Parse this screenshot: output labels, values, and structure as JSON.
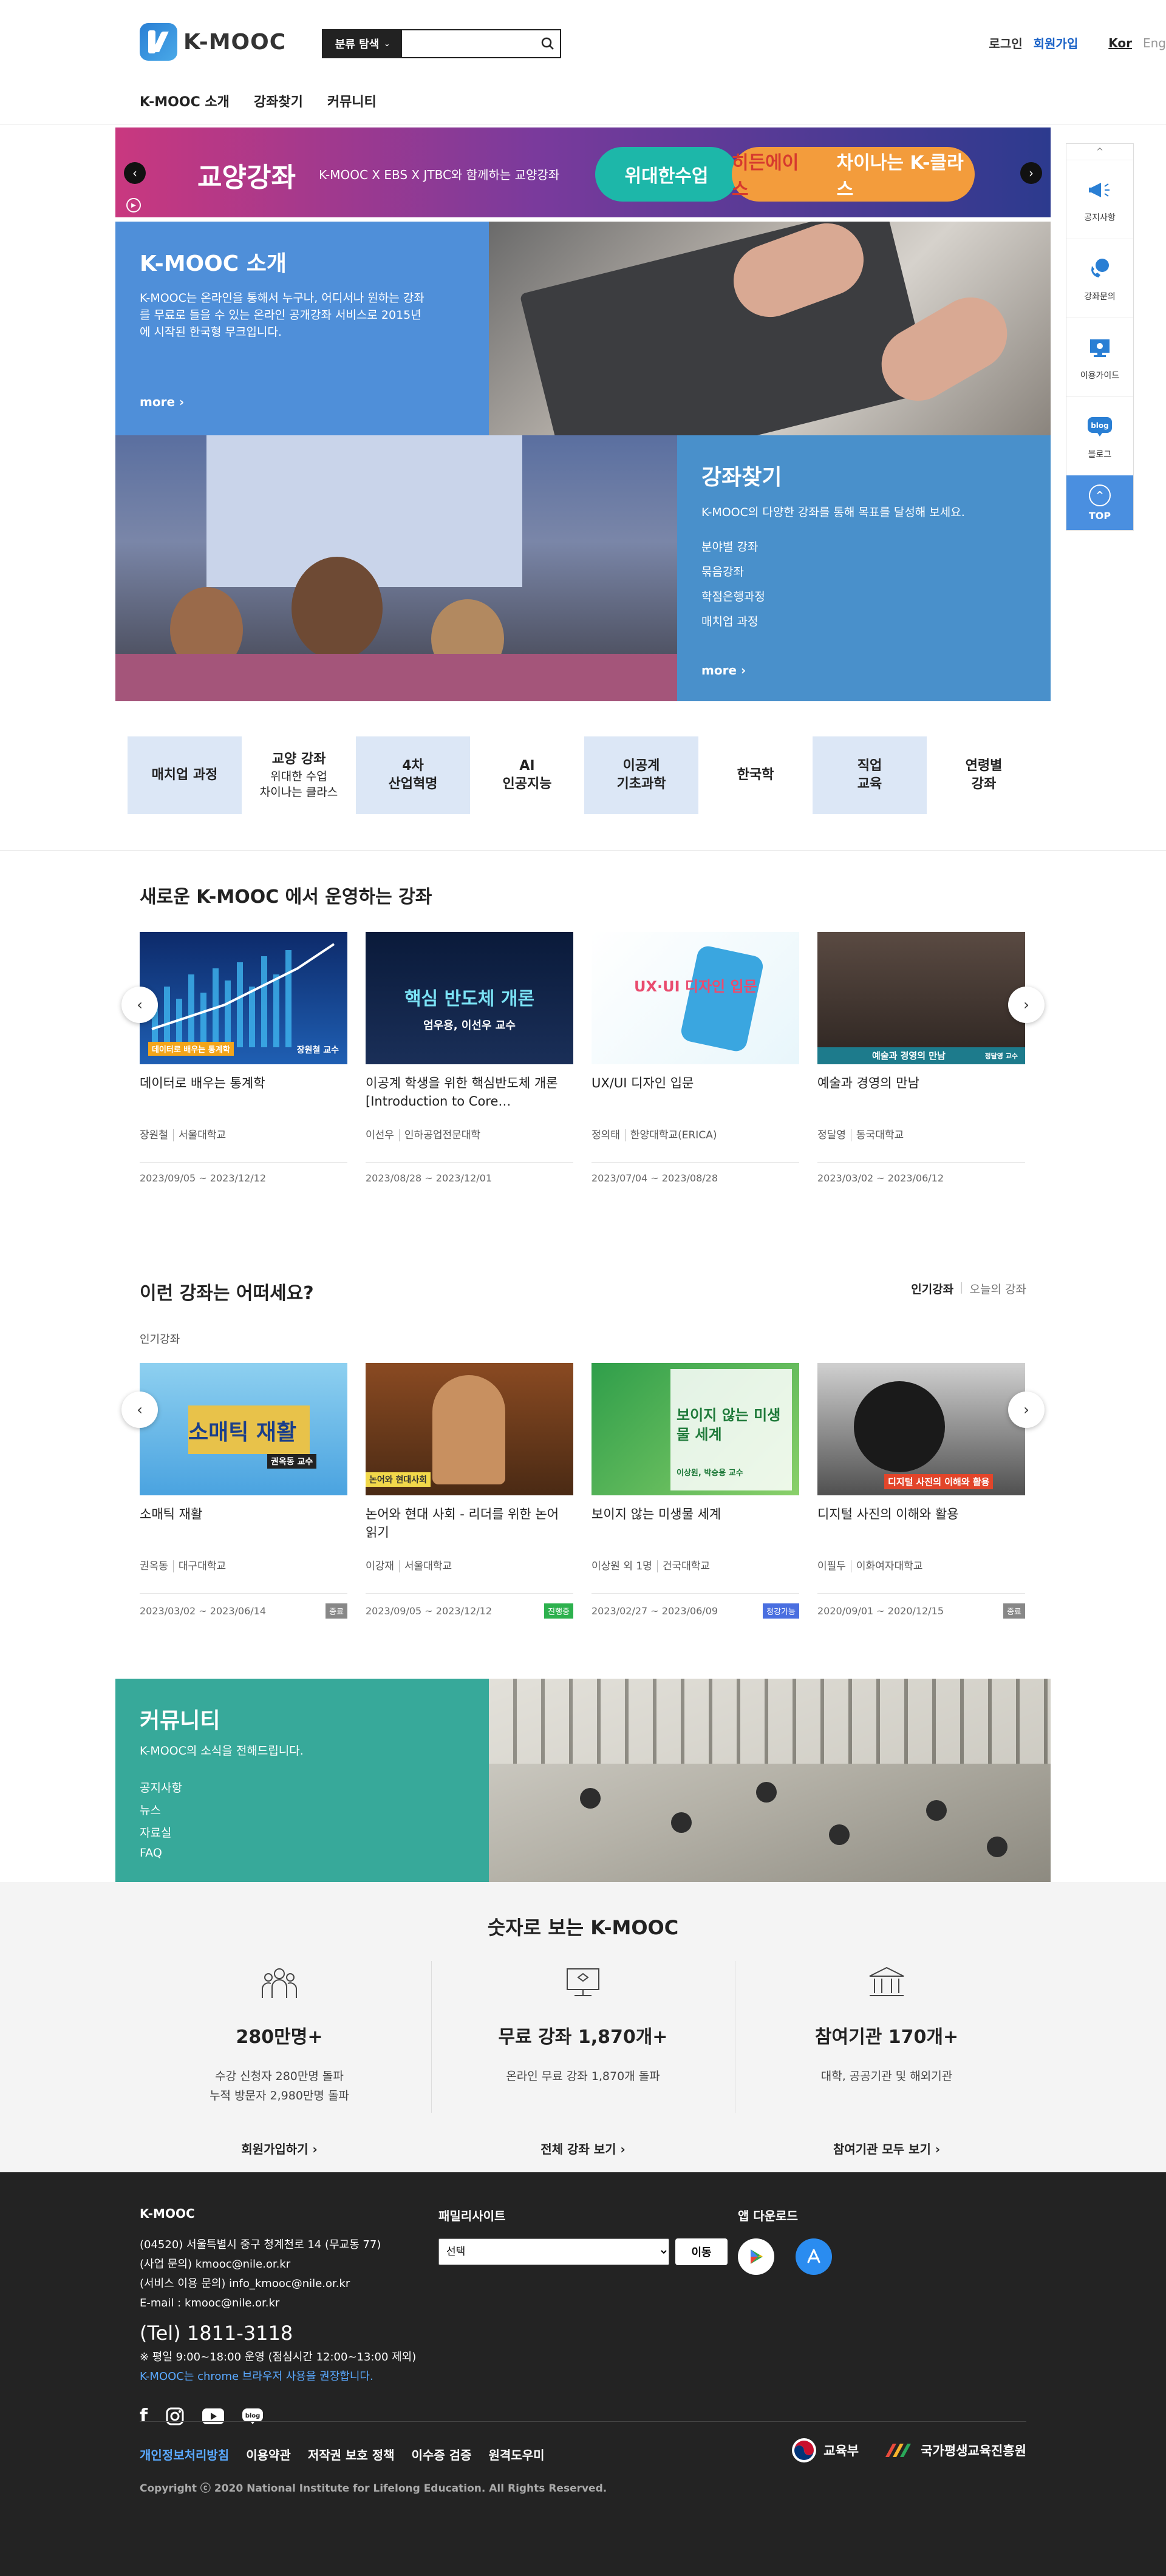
{
  "header": {
    "logo_text": "K-MOOC",
    "search_category": "분류 탐색",
    "search_placeholder": "",
    "login": "로그인",
    "signup": "회원가입",
    "lang_kor": "Kor",
    "lang_eng": "Eng",
    "nav": [
      "K-MOOC 소개",
      "강좌찾기",
      "커뮤니티"
    ]
  },
  "banner": {
    "title": "교양강좌",
    "subtitle": "K-MOOC X EBS X JTBC와 함께하는 교양강좌",
    "pill1": "위대한수업",
    "pill2a": "히든에이스",
    "pill2b": "차이나는 K-클라스"
  },
  "about": {
    "title": "K-MOOC 소개",
    "text": "K-MOOC는 온라인을 통해서 누구나, 어디서나 원하는 강좌를 무료로 들을 수 있는 온라인 공개강좌 서비스로 2015년에 시작된 한국형 무크입니다.",
    "more": "more ›"
  },
  "find": {
    "title": "강좌찾기",
    "text": "K-MOOC의 다양한 강좌를 통해 목표를 달성해 보세요.",
    "items": [
      "분야별 강좌",
      "묶음강좌",
      "학점은행과정",
      "매치업 과정"
    ],
    "more": "more ›"
  },
  "categories": [
    {
      "label": "매치업 과정",
      "sub": "",
      "blue": true
    },
    {
      "label": "교양 강좌",
      "sub": "위대한 수업\n차이나는 클라스",
      "blue": false
    },
    {
      "label": "4차\n산업혁명",
      "sub": "",
      "blue": true
    },
    {
      "label": "AI\n인공지능",
      "sub": "",
      "blue": false
    },
    {
      "label": "이공계\n기초과학",
      "sub": "",
      "blue": true
    },
    {
      "label": "한국학",
      "sub": "",
      "blue": false
    },
    {
      "label": "직업\n교육",
      "sub": "",
      "blue": true
    },
    {
      "label": "연령별\n강좌",
      "sub": "",
      "blue": false
    }
  ],
  "new_courses": {
    "title": "새로운 K-MOOC 에서 운영하는 강좌",
    "items": [
      {
        "title": "데이터로 배우는 통계학",
        "prof": "장원철",
        "univ": "서울대학교",
        "date": "2023/09/05 ~ 2023/12/12",
        "thumb_caption": "데이터로 배우는 통계학",
        "thumb_sub": "장원철 교수",
        "badge": ""
      },
      {
        "title": "이공계 학생을 위한 핵심반도체 개론 [Introduction to Core…",
        "prof": "이선우",
        "univ": "인하공업전문대학",
        "date": "2023/08/28 ~ 2023/12/01",
        "thumb_caption": "핵심 반도체 개론",
        "thumb_sub": "엄우용, 이선우 교수",
        "badge": ""
      },
      {
        "title": "UX/UI 디자인 입문",
        "prof": "정의태",
        "univ": "한양대학교(ERICA)",
        "date": "2023/07/04 ~ 2023/08/28",
        "thumb_caption": "UX·UI 디자인 입문",
        "thumb_sub": "",
        "badge": ""
      },
      {
        "title": "예술과 경영의 만남",
        "prof": "정달영",
        "univ": "동국대학교",
        "date": "2023/03/02 ~ 2023/06/12",
        "thumb_caption": "예술과 경영의 만남",
        "thumb_sub": "정달영 교수",
        "badge": ""
      }
    ]
  },
  "recommend": {
    "title": "이런 강좌는 어떠세요?",
    "tab_on": "인기강좌",
    "tab_off": "오늘의 강좌",
    "sub_label": "인기강좌",
    "items": [
      {
        "title": "소매틱 재활",
        "prof": "권옥동",
        "univ": "대구대학교",
        "date": "2023/03/02 ~ 2023/06/14",
        "thumb_caption": "소매틱 재활",
        "thumb_sub": "권옥동 교수",
        "badge": "종료",
        "badge_type": "end"
      },
      {
        "title": "논어와 현대 사회 - 리더를 위한 논어 읽기",
        "prof": "이강재",
        "univ": "서울대학교",
        "date": "2023/09/05 ~ 2023/12/12",
        "thumb_caption": "논어와 현대사회",
        "thumb_sub": "",
        "badge": "진행중",
        "badge_type": "open"
      },
      {
        "title": "보이지 않는 미생물 세계",
        "prof": "이상원 외 1명",
        "univ": "건국대학교",
        "date": "2023/02/27 ~ 2023/06/09",
        "thumb_caption": "보이지 않는 미생물 세계",
        "thumb_sub": "이상원, 박승용 교수",
        "badge": "청강가능",
        "badge_type": "now"
      },
      {
        "title": "디지털 사진의 이해와 활용",
        "prof": "이필두",
        "univ": "이화여자대학교",
        "date": "2020/09/01 ~ 2020/12/15",
        "thumb_caption": "디지털 사진의 이해와 활용",
        "thumb_sub": "",
        "badge": "종료",
        "badge_type": "end"
      }
    ]
  },
  "community": {
    "title": "커뮤니티",
    "text": "K-MOOC의 소식을 전해드립니다.",
    "items": [
      "공지사항",
      "뉴스",
      "자료실",
      "FAQ"
    ]
  },
  "stats": {
    "title": "숫자로 보는 K-MOOC",
    "items": [
      {
        "num": "280만명+",
        "line1": "수강 신청자 280만명 돌파",
        "line2": "누적 방문자 2,980만명 돌파",
        "link": "회원가입하기 ›"
      },
      {
        "num": "무료 강좌 1,870개+",
        "line1": "온라인 무료 강좌 1,870개 돌파",
        "line2": "",
        "link": "전체 강좌 보기 ›"
      },
      {
        "num": "참여기관 170개+",
        "line1": "대학, 공공기관 및 해외기관",
        "line2": "",
        "link": "참여기관 모두 보기 ›"
      }
    ]
  },
  "footer": {
    "title": "K-MOOC",
    "address": "(04520) 서울특별시 중구 청계천로 14 (무교동 77)",
    "biz_mail": "(사업 문의) kmooc@nile.or.kr",
    "svc_mail": "(서비스 이용 문의) info_kmooc@nile.or.kr",
    "email": "E-mail : kmooc@nile.or.kr",
    "tel": "(Tel) 1811-3118",
    "hours": "※ 평일 9:00~18:00 운영 (점심시간 12:00~13:00 제외)",
    "chrome": "K-MOOC는 chrome 브라우저 사용을 권장합니다.",
    "family_title": "패밀리사이트",
    "family_select": "선택",
    "family_go": "이동",
    "app_title": "앱 다운로드",
    "links": [
      "개인정보처리방침",
      "이용약관",
      "저작권 보호 정책",
      "이수증 검증",
      "원격도우미"
    ],
    "copyright": "Copyright ⓒ 2020 National Institute for Lifelong Education. All Rights Reserved.",
    "org1": "교육부",
    "org2": "국가평생교육진흥원"
  },
  "quick": {
    "items": [
      "공지사항",
      "강좌문의",
      "이용가이드",
      "블로그"
    ],
    "top": "TOP"
  }
}
